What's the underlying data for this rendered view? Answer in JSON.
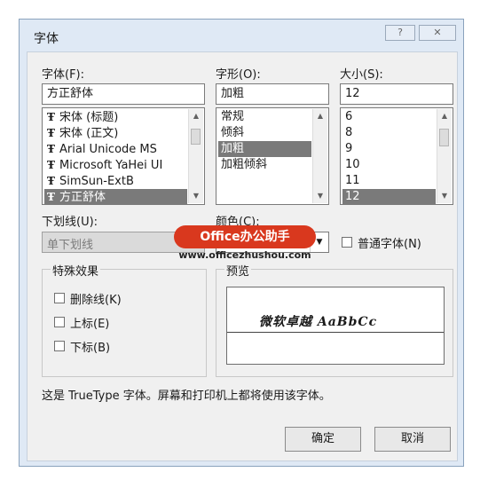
{
  "dialog": {
    "title": "字体",
    "help_label": "?",
    "close_label": "✕"
  },
  "font": {
    "label": "字体(F):",
    "value": "方正舒体",
    "items": [
      {
        "icon": "truetype-icon",
        "label": "宋体 (标题)"
      },
      {
        "icon": "truetype-icon",
        "label": "宋体 (正文)"
      },
      {
        "icon": "truetype-icon",
        "label": "Arial Unicode MS"
      },
      {
        "icon": "truetype-icon",
        "label": "Microsoft YaHei UI"
      },
      {
        "icon": "truetype-icon",
        "label": "SimSun-ExtB"
      },
      {
        "icon": "truetype-icon",
        "label": "方正舒体"
      }
    ],
    "selected_index": 5
  },
  "style": {
    "label": "字形(O):",
    "value": "加粗",
    "items": [
      "常规",
      "倾斜",
      "加粗",
      "加粗倾斜"
    ],
    "selected_index": 2
  },
  "size": {
    "label": "大小(S):",
    "value": "12",
    "items": [
      "6",
      "8",
      "9",
      "10",
      "11",
      "12"
    ],
    "selected_index": 5
  },
  "underline": {
    "label": "下划线(U):",
    "value": "单下划线"
  },
  "color": {
    "label": "颜色(C):",
    "value": "#000000"
  },
  "normal_font": {
    "label": "普通字体(N)",
    "checked": false
  },
  "effects": {
    "title": "特殊效果",
    "items": [
      {
        "label": "删除线(K)",
        "checked": false
      },
      {
        "label": "上标(E)",
        "checked": false
      },
      {
        "label": "下标(B)",
        "checked": false
      }
    ]
  },
  "preview": {
    "title": "预览",
    "sample": "微软卓越 AaBbCc"
  },
  "info_text": "这是 TrueType 字体。屏幕和打印机上都将使用该字体。",
  "buttons": {
    "ok": "确定",
    "cancel": "取消"
  },
  "watermark": {
    "logo": "Office办公助手",
    "url": "www.officezhushou.com"
  },
  "glyphs": {
    "truetype": "Ŧ",
    "up": "▲",
    "down": "▼"
  }
}
